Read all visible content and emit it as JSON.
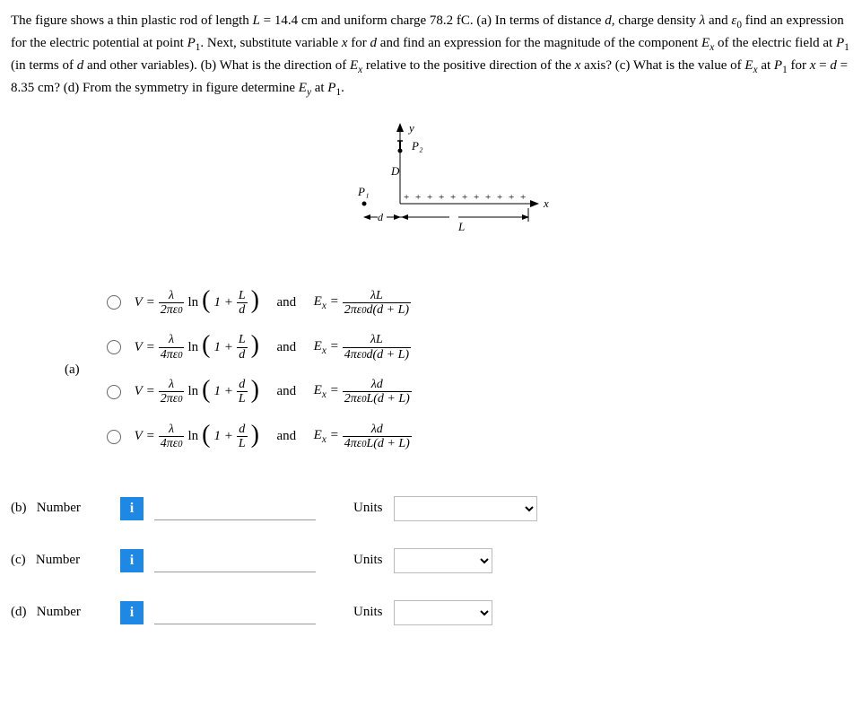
{
  "problem": {
    "text": "The figure shows a thin plastic rod of length L = 14.4 cm and uniform charge 78.2 fC. (a) In terms of distance d, charge density λ and ε₀ find an expression for the electric potential at point P₁. Next, substitute variable x for d and find an expression for the magnitude of the component Eₓ of the electric field at P₁ (in terms of d and other variables). (b) What is the direction of Eₓ relative to the positive direction of the x axis? (c) What is the value of Eₓ at P₁ for x = d = 8.35 cm? (d) From the symmetry in figure determine Eᵧ at P₁.",
    "L_value": "14.4",
    "L_unit": "cm",
    "charge_value": "78.2",
    "charge_unit": "fC",
    "d_value": "8.35",
    "d_unit": "cm"
  },
  "figure": {
    "y_label": "y",
    "x_label": "x",
    "P1_label": "P₁",
    "P2_label": "P₂",
    "D_label": "D",
    "d_label": "d",
    "L_label": "L"
  },
  "part_a": {
    "label": "(a)",
    "options": [
      {
        "coef": "2",
        "inner_num": "L",
        "inner_den": "d",
        "ex_num": "λL",
        "ex_coef": "2",
        "ex_inner": "d(d + L)"
      },
      {
        "coef": "4",
        "inner_num": "L",
        "inner_den": "d",
        "ex_num": "λL",
        "ex_coef": "4",
        "ex_inner": "d(d + L)"
      },
      {
        "coef": "2",
        "inner_num": "d",
        "inner_den": "L",
        "ex_num": "λd",
        "ex_coef": "2",
        "ex_inner": "L(d + L)"
      },
      {
        "coef": "4",
        "inner_num": "d",
        "inner_den": "L",
        "ex_num": "λd",
        "ex_coef": "4",
        "ex_inner": "L(d + L)"
      }
    ],
    "V_eq": "V =",
    "ln": "ln",
    "one_plus": "1 + ",
    "and": "and",
    "Ex_eq": "Eₓ ="
  },
  "answers": {
    "number_label": "Number",
    "units_label": "Units",
    "info": "i",
    "b_label": "(b)",
    "c_label": "(c)",
    "d_label": "(d)"
  }
}
